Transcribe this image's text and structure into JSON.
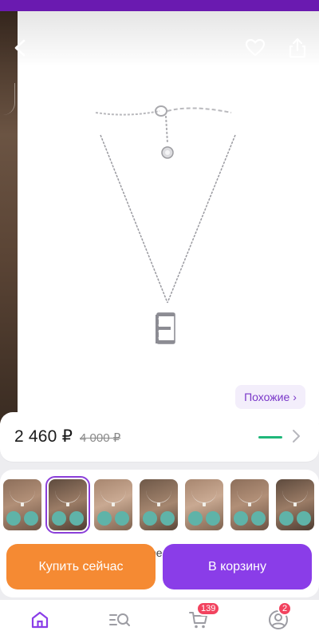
{
  "product": {
    "similar_label": "Похожие",
    "similar_chevron": "›"
  },
  "price": {
    "current": "2 460 ₽",
    "old": "4 000 ₽",
    "accent_color": "#1fb77a"
  },
  "gallery": {
    "thumb_count": 7,
    "selected_index": 1
  },
  "partial_text": "ре",
  "actions": {
    "buy_now": "Купить сейчас",
    "add_to_cart": "В корзину",
    "buy_now_color": "#f58a33",
    "add_to_cart_color": "#8a3de8"
  },
  "nav": {
    "items": [
      {
        "icon": "home-icon",
        "active": true
      },
      {
        "icon": "catalog-search-icon"
      },
      {
        "icon": "cart-icon",
        "badge": "139"
      },
      {
        "icon": "profile-icon",
        "badge": "2"
      }
    ],
    "accent": "#8a3de8"
  }
}
